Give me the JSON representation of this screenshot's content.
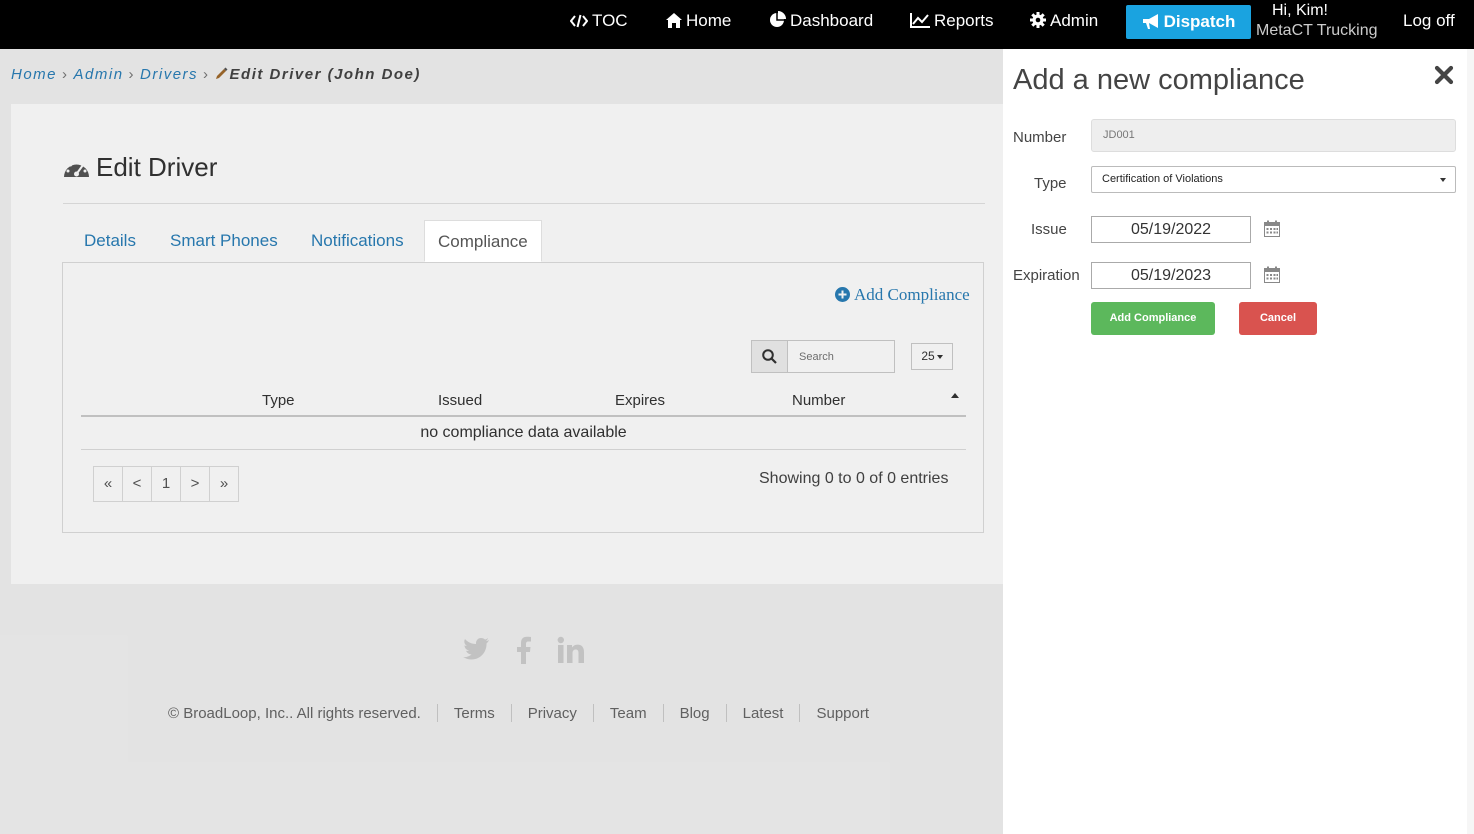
{
  "nav": {
    "toc": "TOC",
    "home": "Home",
    "dashboard": "Dashboard",
    "reports": "Reports",
    "admin": "Admin",
    "dispatch": "Dispatch",
    "greeting": "Hi, Kim!",
    "company": "MetaCT Trucking",
    "logoff": "Log off"
  },
  "breadcrumb": {
    "home": "Home",
    "admin": "Admin",
    "drivers": "Drivers",
    "current": "Edit Driver (John Doe)"
  },
  "page": {
    "title": "Edit Driver"
  },
  "tabs": [
    {
      "label": "Details"
    },
    {
      "label": "Smart Phones"
    },
    {
      "label": "Notifications"
    },
    {
      "label": "Compliance",
      "active": true
    }
  ],
  "compliance": {
    "add_link": "Add Compliance",
    "search_placeholder": "Search",
    "page_size": "25",
    "columns": [
      "Type",
      "Issued",
      "Expires",
      "Number"
    ],
    "empty_message": "no compliance data available",
    "pager": [
      "«",
      "<",
      "1",
      ">",
      "»"
    ],
    "showing": "Showing 0 to 0 of 0 entries"
  },
  "footer": {
    "copyright": "© BroadLoop, Inc.. All rights reserved.",
    "links": [
      "Terms",
      "Privacy",
      "Team",
      "Blog",
      "Latest",
      "Support"
    ]
  },
  "panel": {
    "title": "Add a new compliance",
    "number_label": "Number",
    "number_value": "JD001",
    "type_label": "Type",
    "type_value": "Certification of Violations",
    "issue_label": "Issue",
    "issue_value": "05/19/2022",
    "expiration_label": "Expiration",
    "expiration_value": "05/19/2023",
    "add_button": "Add Compliance",
    "cancel_button": "Cancel"
  },
  "icons": {
    "toc": "code-icon",
    "home": "home-icon",
    "dashboard": "pie-chart-icon",
    "reports": "line-chart-icon",
    "admin": "gear-icon",
    "dispatch": "bullhorn-icon",
    "title": "tachometer-icon",
    "add": "plus-circle-icon",
    "search": "search-icon",
    "calendar": "calendar-icon",
    "close": "close-icon",
    "social": [
      "twitter-icon",
      "facebook-icon",
      "linkedin-icon"
    ]
  },
  "colors": {
    "link": "#2a7fb8",
    "dispatch": "#1aa3e0",
    "add_button": "#5cb85c",
    "cancel_button": "#d9534f",
    "navbar": "#000000"
  }
}
